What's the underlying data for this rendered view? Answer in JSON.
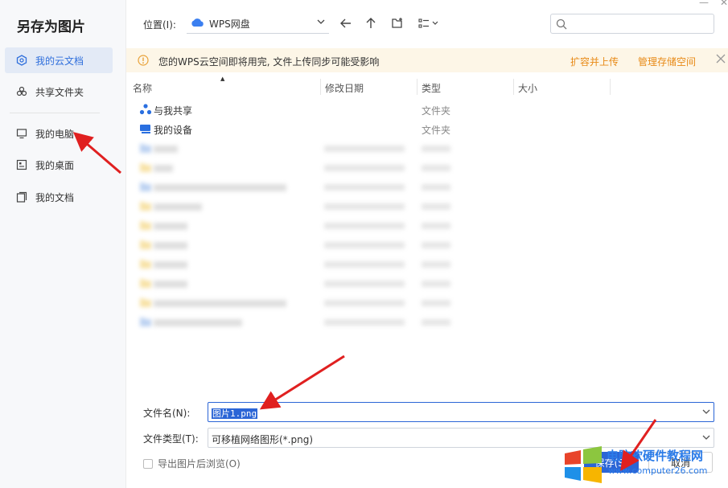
{
  "dialog": {
    "title": "另存为图片"
  },
  "sidebar": {
    "items": [
      {
        "label": "我的云文档",
        "icon": "cloud-doc-icon"
      },
      {
        "label": "共享文件夹",
        "icon": "share-folder-icon"
      },
      {
        "label": "我的电脑",
        "icon": "monitor-icon"
      },
      {
        "label": "我的桌面",
        "icon": "desktop-icon"
      },
      {
        "label": "我的文档",
        "icon": "documents-icon"
      }
    ]
  },
  "location": {
    "label": "位置(I):",
    "value": "WPS网盘"
  },
  "search": {
    "placeholder": ""
  },
  "notice": {
    "message": "您的WPS云空间即将用完, 文件上传同步可能受影响",
    "expand_link": "扩容并上传",
    "manage_link": "管理存储空间"
  },
  "columns": {
    "name": "名称",
    "modified": "修改日期",
    "type": "类型",
    "size": "大小"
  },
  "rows": [
    {
      "name": "与我共享",
      "date": "",
      "type": "文件夹",
      "icon": "shared-people-icon"
    },
    {
      "name": "我的设备",
      "date": "",
      "type": "文件夹",
      "icon": "device-icon"
    }
  ],
  "form": {
    "filename_label": "文件名(N):",
    "filename_value": "图片1.png",
    "filetype_label": "文件类型(T):",
    "filetype_value": "可移植网络图形(*.png)",
    "export_checkbox_label": "导出图片后浏览(O)",
    "save_label": "保存(S)",
    "cancel_label": "取消"
  },
  "watermark": {
    "title": "电脑软硬件教程网",
    "url": "www.computer26.com"
  },
  "colors": {
    "accent": "#2b65d6",
    "annotation_arrow": "#e02020",
    "notice_bg": "#fdf6e7",
    "notice_link": "#e88a17"
  }
}
